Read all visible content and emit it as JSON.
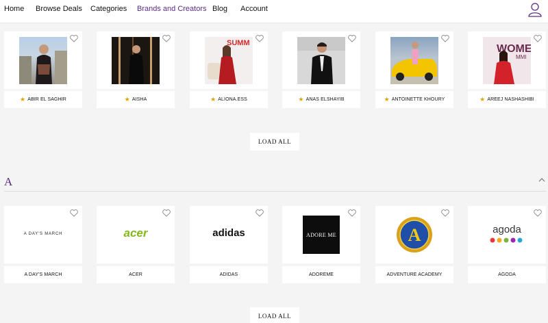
{
  "nav": {
    "items": [
      "Home",
      "Browse Deals",
      "Categories",
      "Brands and Creators",
      "Blog",
      "Account"
    ]
  },
  "creators": [
    {
      "name": "ABIR EL SAGHIR"
    },
    {
      "name": "AISHA"
    },
    {
      "name": "ALIONA.ESS"
    },
    {
      "name": "ANAS ELSHAYIB"
    },
    {
      "name": "ANTOINETTE KHOURY"
    },
    {
      "name": "AREEJ NASHASHIBI"
    }
  ],
  "load_all_label": "LOAD ALL",
  "section": {
    "letter": "A",
    "brands": [
      {
        "name": "A DAY'S MARCH",
        "logo": "A DAY'S MARCH"
      },
      {
        "name": "ACER",
        "logo": "acer"
      },
      {
        "name": "ADIDAS",
        "logo": "adidas"
      },
      {
        "name": "ADOREME",
        "logo": "ADORE ME"
      },
      {
        "name": "ADVENTURE ACADEMY",
        "logo": "A"
      },
      {
        "name": "AGODA",
        "logo": "agoda"
      }
    ]
  },
  "photo_texts": {
    "summit": "SUMM",
    "women": "WOME",
    "women_sub": "MMI"
  },
  "colors": {
    "accent": "#5b2a86",
    "star": "#e0a400",
    "acer_green": "#83b81a"
  }
}
